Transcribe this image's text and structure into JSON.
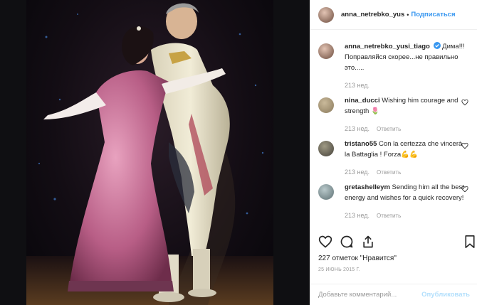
{
  "post": {
    "author": "anna_netrebko_yus",
    "separator": "•",
    "follow_label": "Подписаться",
    "photo_alt": "",
    "caption": {
      "username": "anna_netrebko_yusi_tiago",
      "verified_icon": "verified-badge-icon",
      "text": "Дима!!! Поправляйся скорее...не правильно это.....",
      "time": "213 нед."
    },
    "comments": [
      {
        "username": "nina_ducci",
        "text": "Wishing him courage and strength 🌷",
        "time": "213 нед.",
        "reply_label": "Ответить",
        "avatar_color": "#8a7a5c"
      },
      {
        "username": "tristano55",
        "text": "Con la certezza che vincerà la Battaglia ! Forza💪💪",
        "time": "213 нед.",
        "reply_label": "Ответить",
        "avatar_color": "#5e5a4a"
      },
      {
        "username": "gretashelleym",
        "text": "Sending him all the best energy and wishes for a quick recovery!",
        "time": "213 нед.",
        "reply_label": "Ответить",
        "avatar_color": "#7b8f93"
      }
    ],
    "actions": {
      "like_icon": "heart-icon",
      "comment_icon": "comment-icon",
      "share_icon": "share-icon",
      "save_icon": "bookmark-icon"
    },
    "likes_text": "227 отметок \"Нравится\"",
    "date_text": "25 ИЮНЬ 2015 Г.",
    "add_comment_placeholder": "Добавьте комментарий...",
    "publish_label": "Опубликовать",
    "colors": {
      "link": "#3897f0",
      "publish_disabled": "#b2dffc",
      "muted": "#999999"
    }
  }
}
